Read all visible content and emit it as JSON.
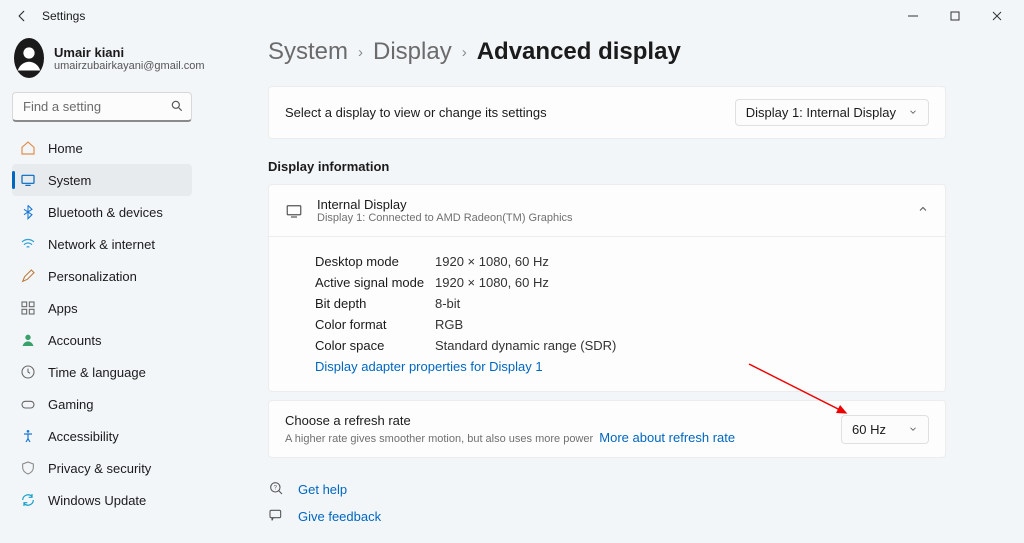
{
  "titlebar": {
    "title": "Settings"
  },
  "user": {
    "name": "Umair kiani",
    "email": "umairzubairkayani@gmail.com"
  },
  "search": {
    "placeholder": "Find a setting"
  },
  "nav": {
    "items": [
      {
        "label": "Home"
      },
      {
        "label": "System"
      },
      {
        "label": "Bluetooth & devices"
      },
      {
        "label": "Network & internet"
      },
      {
        "label": "Personalization"
      },
      {
        "label": "Apps"
      },
      {
        "label": "Accounts"
      },
      {
        "label": "Time & language"
      },
      {
        "label": "Gaming"
      },
      {
        "label": "Accessibility"
      },
      {
        "label": "Privacy & security"
      },
      {
        "label": "Windows Update"
      }
    ]
  },
  "breadcrumbs": {
    "a": "System",
    "b": "Display",
    "c": "Advanced display"
  },
  "selector": {
    "prompt": "Select a display to view or change its settings",
    "value": "Display 1: Internal Display"
  },
  "display_info": {
    "section": "Display information",
    "title": "Internal Display",
    "sub": "Display 1: Connected to AMD Radeon(TM) Graphics",
    "rows": [
      {
        "label": "Desktop mode",
        "value": "1920 × 1080, 60 Hz"
      },
      {
        "label": "Active signal mode",
        "value": "1920 × 1080, 60 Hz"
      },
      {
        "label": "Bit depth",
        "value": "8-bit"
      },
      {
        "label": "Color format",
        "value": "RGB"
      },
      {
        "label": "Color space",
        "value": "Standard dynamic range (SDR)"
      }
    ],
    "adapter_link": "Display adapter properties for Display 1"
  },
  "refresh": {
    "title": "Choose a refresh rate",
    "sub": "A higher rate gives smoother motion, but also uses more power",
    "link": "More about refresh rate",
    "value": "60 Hz"
  },
  "help": {
    "get": "Get help",
    "feedback": "Give feedback"
  }
}
